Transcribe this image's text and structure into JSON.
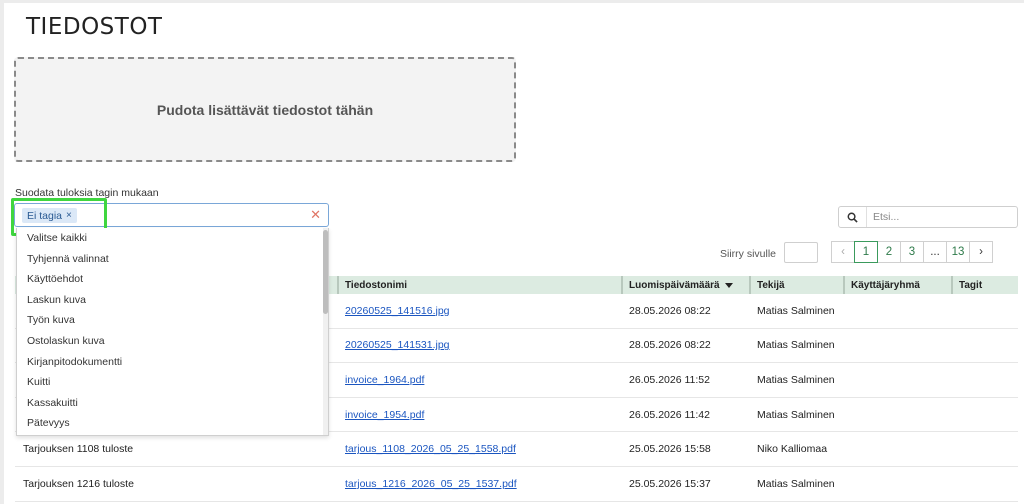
{
  "page": {
    "title": "TIEDOSTOT"
  },
  "dropzone": {
    "text": "Pudota lisättävät tiedostot tähän"
  },
  "filter": {
    "label": "Suodata tuloksia tagin mukaan",
    "selected_tag": "Ei tagia",
    "chip_remove": "×",
    "clear": "✕",
    "options": [
      "Valitse kaikki",
      "Tyhjennä valinnat",
      "Käyttöehdot",
      "Laskun kuva",
      "Työn kuva",
      "Ostolaskun kuva",
      "Kirjanpitodokumentti",
      "Kuitti",
      "Kassakuitti",
      "Pätevyys"
    ]
  },
  "search": {
    "placeholder": "Etsi...",
    "value": ""
  },
  "pagination": {
    "goto_label": "Siirry sivulle",
    "prev": "‹",
    "pages": [
      "1",
      "2",
      "3",
      "...",
      "13"
    ],
    "current": "1",
    "next": "›"
  },
  "table": {
    "headers": [
      "",
      "Tiedostonimi",
      "Luomispäivämäärä",
      "Tekijä",
      "Käyttäjäryhmä",
      "Tagit"
    ],
    "sort_column": "Luomispäivämäärä",
    "sort_direction": "desc",
    "rows": [
      {
        "title": "",
        "filename": "20260525_141516.jpg",
        "created": "28.05.2026 08:22",
        "author": "Matias Salminen",
        "group": "",
        "tags": ""
      },
      {
        "title": "",
        "filename": "20260525_141531.jpg",
        "created": "28.05.2026 08:22",
        "author": "Matias Salminen",
        "group": "",
        "tags": ""
      },
      {
        "title": "",
        "filename": "invoice_1964.pdf",
        "created": "26.05.2026 11:52",
        "author": "Matias Salminen",
        "group": "",
        "tags": ""
      },
      {
        "title": "",
        "filename": "invoice_1954.pdf",
        "created": "26.05.2026 11:42",
        "author": "Matias Salminen",
        "group": "",
        "tags": ""
      },
      {
        "title": "Tarjouksen 1108 tuloste",
        "filename": "tarjous_1108_2026_05_25_1558.pdf",
        "created": "25.05.2026 15:58",
        "author": "Niko Kalliomaa",
        "group": "",
        "tags": ""
      },
      {
        "title": "Tarjouksen 1216 tuloste",
        "filename": "tarjous_1216_2026_05_25_1537.pdf",
        "created": "25.05.2026 15:37",
        "author": "Matias Salminen",
        "group": "",
        "tags": ""
      }
    ]
  },
  "colors": {
    "highlight": "#3fd63f",
    "header_bg": "#dcebe1",
    "link": "#1a55c0",
    "pager_active": "#3a9a5c"
  }
}
